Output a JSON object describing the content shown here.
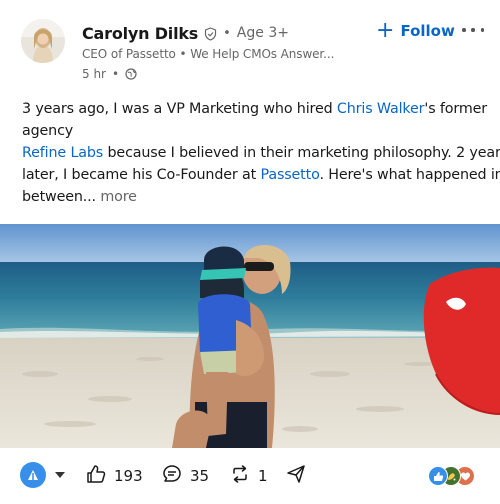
{
  "post": {
    "author": {
      "name": "Carolyn Dilks",
      "separator": "•",
      "degree": "Age 3+",
      "headline": "CEO of Passetto • We Help CMOs Answer...",
      "time": "5 hr",
      "time_separator": "•"
    },
    "follow_label": "Follow",
    "body": {
      "line1_pre": "3 years ago, I was a VP Marketing who hired ",
      "mention1": "Chris Walker",
      "line1_post": "'s former",
      "line2": "agency",
      "mention2": "Refine Labs",
      "line3_post": " because I believed in their marketing philosophy. 2 years",
      "line4_pre": "later, I became his Co-Founder at ",
      "mention3": "Passetto",
      "line4_post": ". Here's what happened in",
      "line5_pre": "between...",
      "see_more": " more"
    },
    "image": {
      "subject": "beach-photo"
    }
  },
  "actions": {
    "likes": "193",
    "comments": "35",
    "reposts": "1"
  },
  "colors": {
    "link": "#0a66c2",
    "like": "#378fe9",
    "celebrate": "#44712e",
    "love": "#df704d"
  },
  "icons": [
    "verified-shield-icon",
    "globe-icon",
    "like-icon",
    "comment-icon",
    "repost-icon",
    "send-icon"
  ]
}
